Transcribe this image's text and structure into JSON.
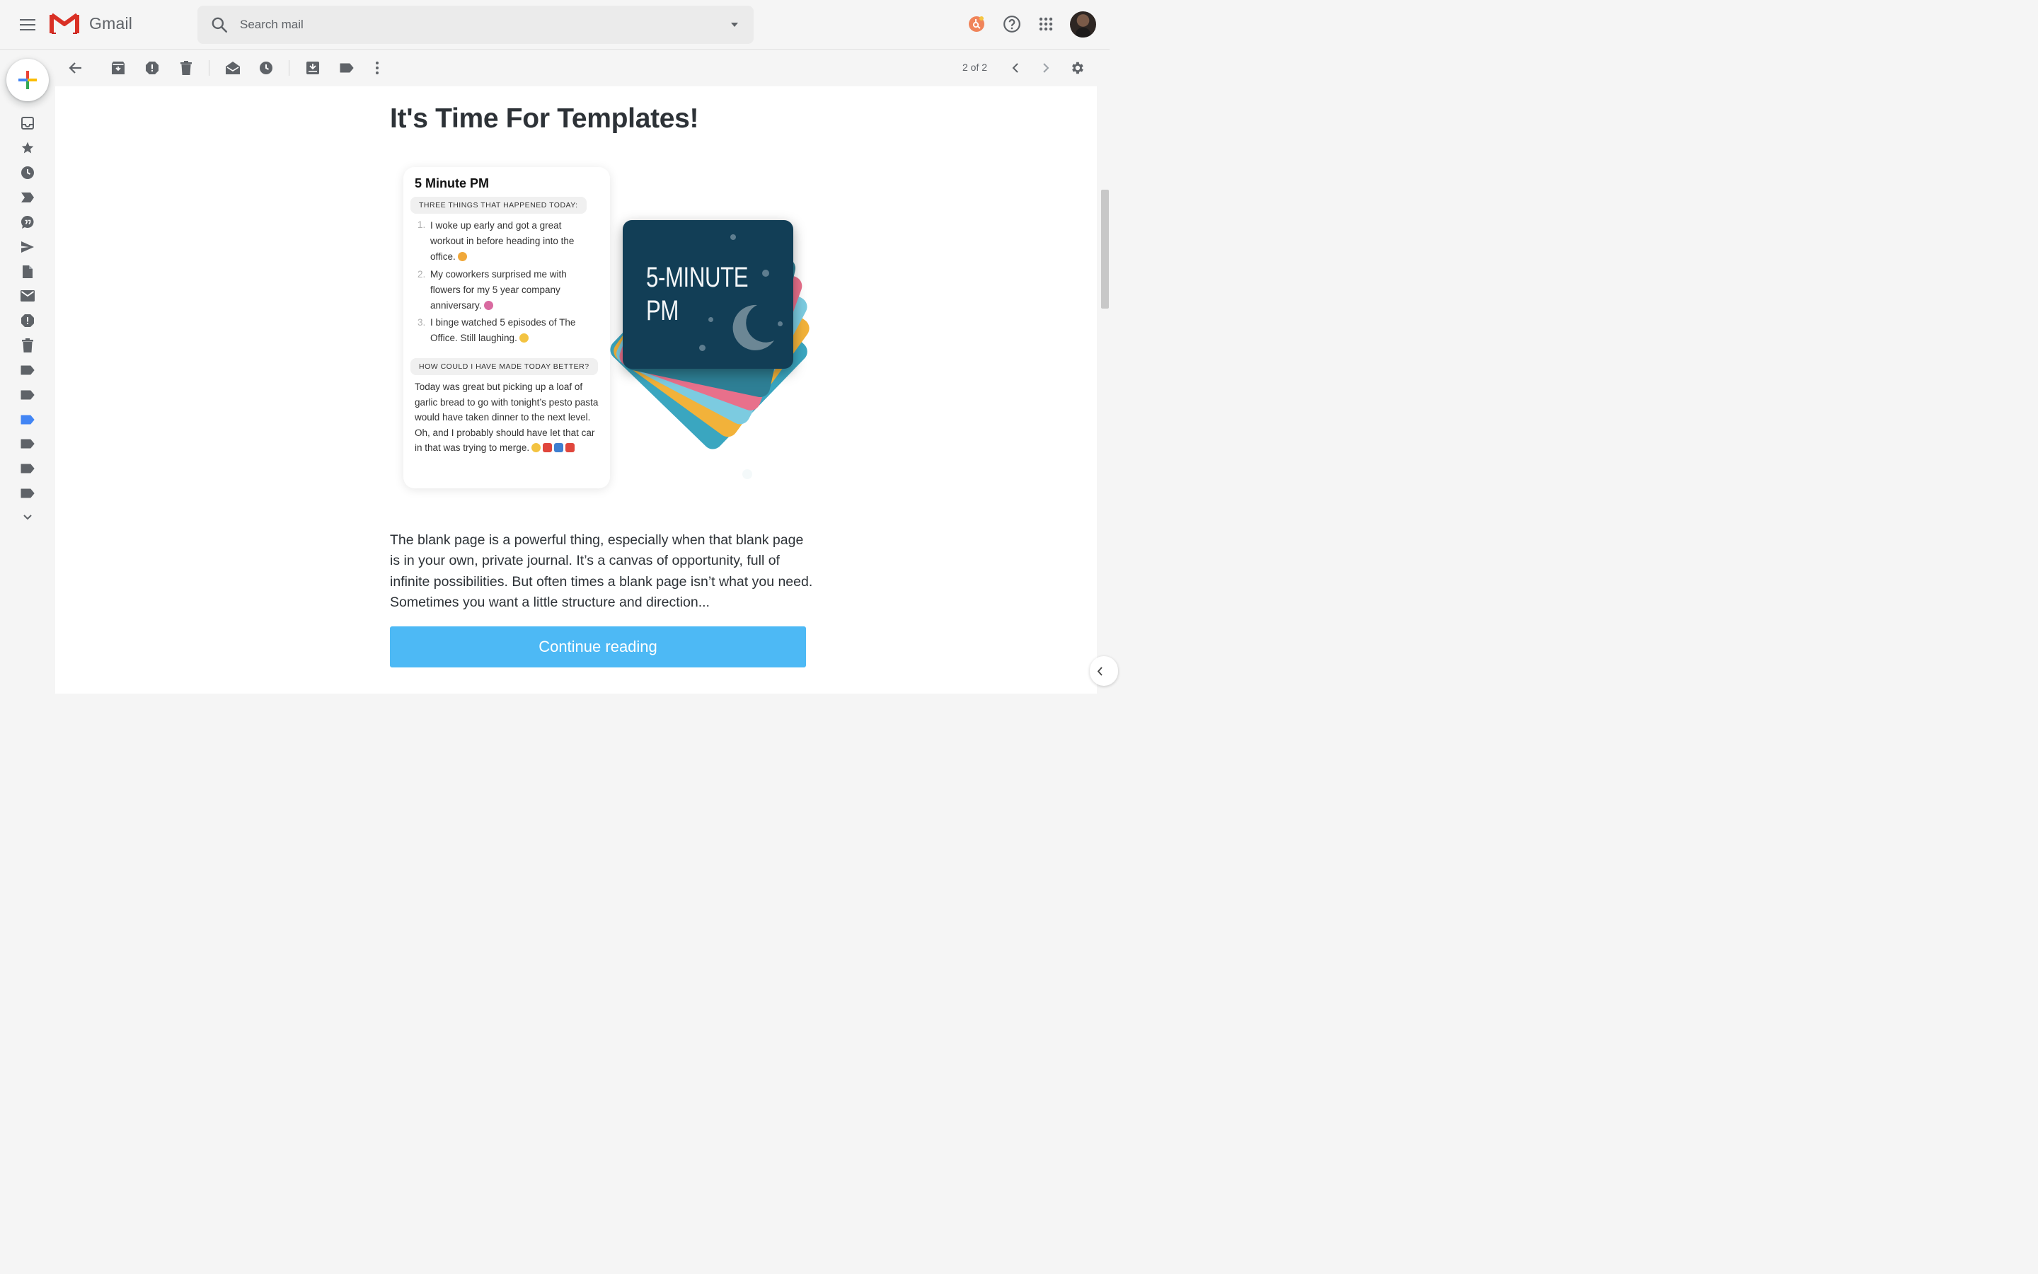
{
  "app": {
    "name": "Gmail"
  },
  "search": {
    "placeholder": "Search mail"
  },
  "toolbar": {
    "pager": "2 of 2"
  },
  "message": {
    "headline": "It's Time For Templates!",
    "template_card": {
      "title": "5 Minute PM",
      "section1_label": "THREE THINGS THAT HAPPENED TODAY:",
      "items": [
        {
          "num": "1.",
          "text": "I woke up early and got a great workout in before heading into the office."
        },
        {
          "num": "2.",
          "text": "My coworkers surprised me with flowers for my 5 year company anniversary."
        },
        {
          "num": "3.",
          "text": "I binge watched 5 episodes of The Office. Still laughing."
        }
      ],
      "section2_label": "HOW COULD I HAVE MADE TODAY BETTER?",
      "paragraph": "Today was great but picking up a loaf of garlic bread to go with tonight’s pesto pasta would have taken dinner to the next level. Oh, and I probably should have let that car in that was trying to merge."
    },
    "deck_card_title": "5-MINUTE\nPM",
    "body": "The blank page is a powerful thing, especially when that blank page is in your own, private journal. It’s a canvas of opportunity, full of infinite possibilities. But often times a blank page isn’t what you need. Sometimes you want a little structure and direction...",
    "cta_label": "Continue reading"
  },
  "colors": {
    "accent_blue": "#4db9f5",
    "deck_navy": "#123e56",
    "deck_teal": "#2e7f95",
    "deck_pink": "#e8708b",
    "deck_sky": "#7ccbe0",
    "deck_yellow": "#f2b23a",
    "deck_cyan": "#3aa6c0"
  },
  "icons": {
    "topbar": [
      "menu-icon",
      "gmail-logo",
      "search-icon",
      "search-options-icon",
      "hubspot-icon",
      "help-icon",
      "apps-grid-icon"
    ],
    "rail": [
      "inbox-icon",
      "star-icon",
      "snoozed-icon",
      "important-icon",
      "chats-icon",
      "sent-icon",
      "drafts-icon",
      "all-mail-icon",
      "spam-icon",
      "trash-icon",
      "label-icon",
      "label-icon",
      "label-blue-icon",
      "label-icon",
      "label-icon",
      "label-icon",
      "more-chevron-icon"
    ],
    "toolbar": [
      "back-arrow-icon",
      "archive-icon",
      "report-spam-icon",
      "delete-icon",
      "mark-unread-icon",
      "snooze-icon",
      "move-to-icon",
      "labels-icon",
      "more-vert-icon",
      "prev-icon",
      "next-icon",
      "settings-gear-icon"
    ]
  }
}
